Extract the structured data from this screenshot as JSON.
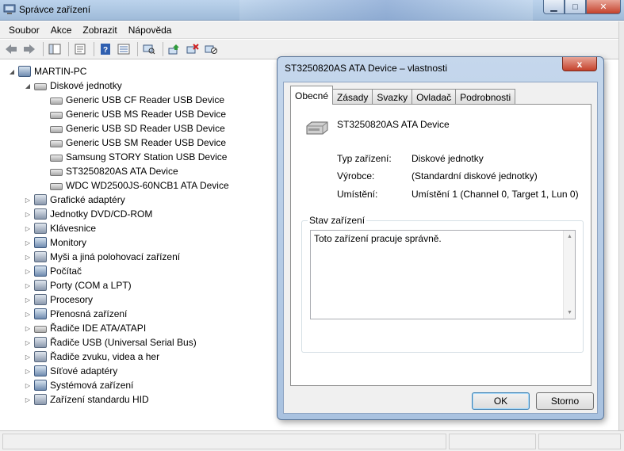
{
  "window": {
    "title": "Správce zařízení"
  },
  "menu": [
    "Soubor",
    "Akce",
    "Zobrazit",
    "Nápověda"
  ],
  "toolbar": {
    "icons": [
      "back-arrow-icon",
      "forward-arrow-icon",
      "show-hide-tree-icon",
      "properties-icon",
      "help-icon",
      "view-icon",
      "scan-hardware-icon",
      "update-driver-icon",
      "uninstall-icon",
      "disable-icon"
    ]
  },
  "tree": {
    "root": "MARTIN-PC",
    "disk_category": "Diskové jednotky",
    "disks": [
      "Generic USB CF Reader USB Device",
      "Generic USB MS Reader USB Device",
      "Generic USB SD Reader USB Device",
      "Generic USB SM Reader USB Device",
      "Samsung STORY Station USB Device",
      "ST3250820AS ATA Device",
      "WDC WD2500JS-60NCB1 ATA Device"
    ],
    "categories": [
      "Grafické adaptéry",
      "Jednotky DVD/CD-ROM",
      "Klávesnice",
      "Monitory",
      "Myši a jiná polohovací zařízení",
      "Počítač",
      "Porty (COM a LPT)",
      "Procesory",
      "Přenosná zařízení",
      "Řadiče IDE ATA/ATAPI",
      "Řadiče USB (Universal Serial Bus)",
      "Řadiče zvuku, videa a her",
      "Síťové adaptéry",
      "Systémová zařízení",
      "Zařízení standardu HID"
    ]
  },
  "dialog": {
    "title": "ST3250820AS ATA Device – vlastnosti",
    "close_glyph": "x",
    "tabs": [
      "Obecné",
      "Zásady",
      "Svazky",
      "Ovladač",
      "Podrobnosti"
    ],
    "device_name": "ST3250820AS ATA Device",
    "props": [
      {
        "label": "Typ zařízení:",
        "value": "Diskové jednotky"
      },
      {
        "label": "Výrobce:",
        "value": "(Standardní diskové jednotky)"
      },
      {
        "label": "Umístění:",
        "value": "Umístění 1 (Channel 0, Target 1, Lun 0)"
      }
    ],
    "status_title": "Stav zařízení",
    "status_text": "Toto zařízení pracuje správně.",
    "ok": "OK",
    "cancel": "Storno"
  }
}
